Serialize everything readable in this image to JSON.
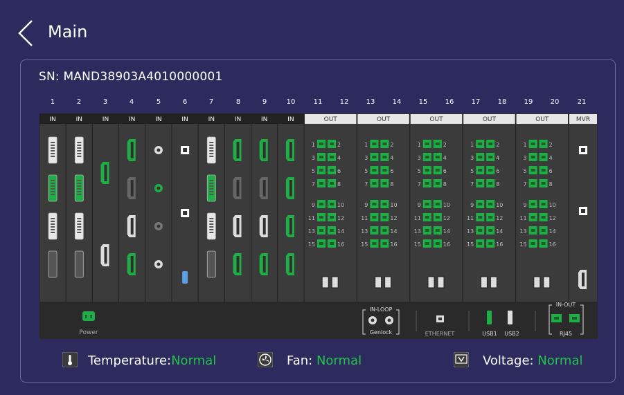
{
  "header": {
    "title": "Main"
  },
  "panel": {
    "sn": "SN: MAND38903A4010000001"
  },
  "slots": {
    "numbers": [
      "1",
      "2",
      "3",
      "4",
      "5",
      "6",
      "7",
      "8",
      "9",
      "10",
      "11",
      "12",
      "13",
      "14",
      "15",
      "16",
      "17",
      "18",
      "19",
      "20",
      "21"
    ],
    "in_label": "IN",
    "out_label": "OUT",
    "mvr_label": "MVR",
    "port_numbers": [
      "1",
      "2",
      "3",
      "4",
      "5",
      "6",
      "7",
      "8",
      "9",
      "10",
      "11",
      "12",
      "13",
      "14",
      "15",
      "16"
    ]
  },
  "bottom": {
    "power": "Power",
    "inloop": "IN-LOOP",
    "genlock": "Genlock",
    "ethernet": "ETHERNET",
    "usb1": "USB1",
    "usb2": "USB2",
    "inout": "IN-OUT",
    "rj45": "RJ45"
  },
  "status": {
    "temperature_label": "Temperature:",
    "temperature_value": "Normal",
    "fan_label": "Fan:",
    "fan_value": "Normal",
    "voltage_label": "Voltage:",
    "voltage_value": "Normal"
  },
  "colors": {
    "background": "#2d2b5e",
    "ok_green": "#22c54a",
    "port_green": "#1fae45"
  },
  "icons": {
    "back": "chevron-left-icon",
    "power": "power-socket-icon",
    "temperature": "thermometer-icon",
    "fan": "fan-icon",
    "voltage": "voltage-icon"
  }
}
